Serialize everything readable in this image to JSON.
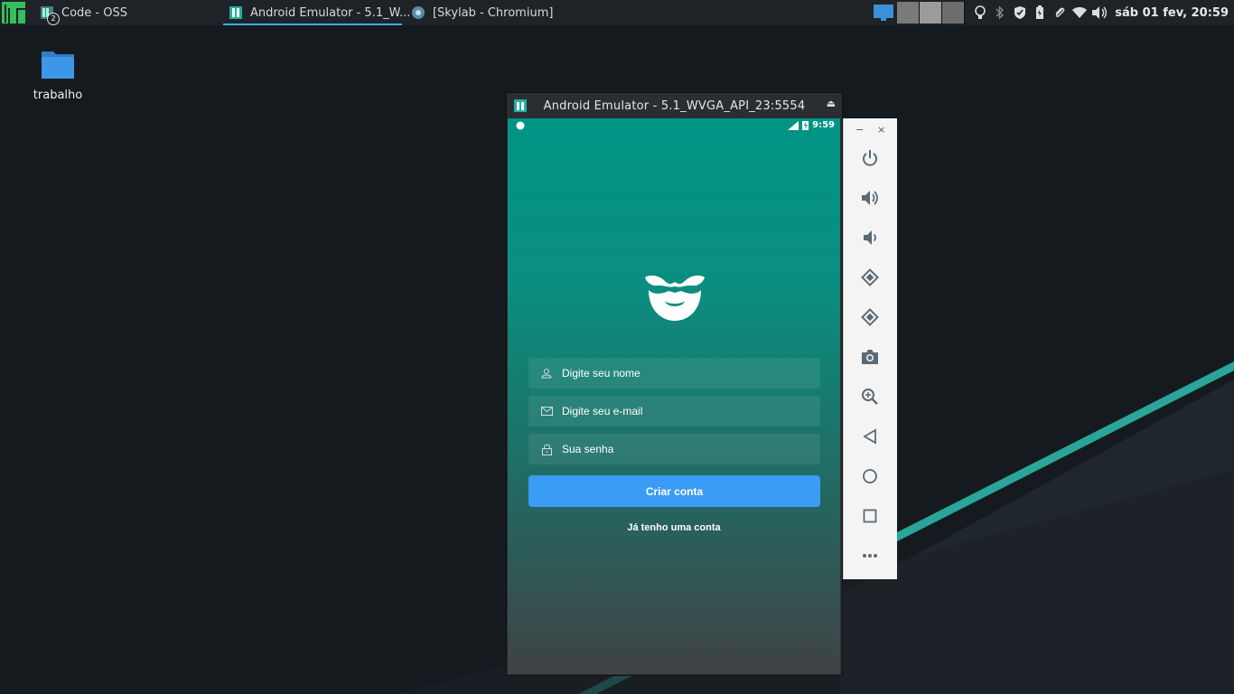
{
  "taskbar": {
    "tasks": [
      {
        "label": "Code - OSS",
        "badge": "2",
        "icon": "code-oss-icon"
      },
      {
        "label": "Android Emulator - 5.1_W...",
        "icon": "android-emulator-icon",
        "active": true
      },
      {
        "label": "[Skylab - Chromium]",
        "icon": "chromium-icon"
      }
    ],
    "clock": "sáb 01 fev, 20:59",
    "accent": "#3daee9"
  },
  "desktop": {
    "icons": [
      {
        "label": "trabalho",
        "icon": "folder-icon"
      }
    ]
  },
  "emulator": {
    "title": "Android Emulator - 5.1_WVGA_API_23:5554",
    "status_time": "9:59",
    "app": {
      "fields": [
        {
          "placeholder": "Digite seu nome",
          "icon": "user-icon"
        },
        {
          "placeholder": "Digite seu e-mail",
          "icon": "mail-icon"
        },
        {
          "placeholder": "Sua senha",
          "icon": "lock-icon"
        }
      ],
      "primary_button": "Criar conta",
      "secondary_link": "Já tenho uma conta",
      "button_color": "#3a9cf5"
    },
    "toolbar": {
      "minimize": "−",
      "close": "×",
      "buttons": [
        "power-icon",
        "volume-up-icon",
        "volume-down-icon",
        "rotate-left-icon",
        "rotate-right-icon",
        "camera-icon",
        "zoom-icon",
        "back-icon",
        "home-icon",
        "overview-icon",
        "more-icon"
      ]
    }
  }
}
